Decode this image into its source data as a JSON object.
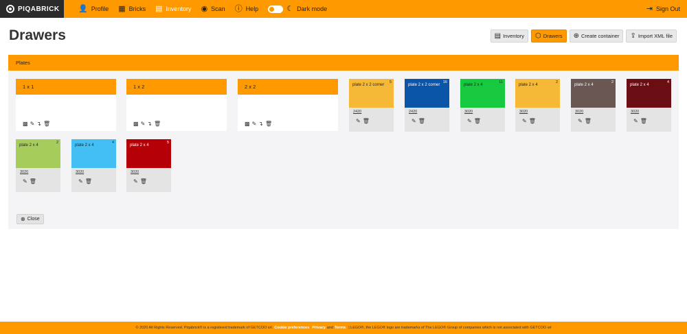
{
  "nav": {
    "brand": "PIQABRICK",
    "items": [
      {
        "label": "Profile",
        "icon": "user-icon",
        "glyph": "👤"
      },
      {
        "label": "Bricks",
        "icon": "grid-icon",
        "glyph": "▦"
      },
      {
        "label": "Inventory",
        "icon": "inventory-box-icon",
        "glyph": "▤"
      },
      {
        "label": "Scan",
        "icon": "eye-icon",
        "glyph": "◉"
      },
      {
        "label": "Help",
        "icon": "help-circle-icon",
        "glyph": "?"
      }
    ],
    "dark_mode_label": "Dark mode",
    "sign_out_label": "Sign Out"
  },
  "page": {
    "title": "Drawers",
    "actions": {
      "inventory": "Inventory",
      "drawers": "Drawers",
      "create": "Create container",
      "import": "Import XML file"
    }
  },
  "section": {
    "title": "Plates",
    "drawers": [
      {
        "label": "1 x 1"
      },
      {
        "label": "1 x 2"
      },
      {
        "label": "2 x 2"
      }
    ],
    "bricks": [
      {
        "name": "plate 2 x 2 corner",
        "count": "5",
        "part": "2420",
        "color": "#f6b937",
        "text": "#222"
      },
      {
        "name": "plate 2 x 2 corner",
        "count": "16",
        "part": "2420",
        "color": "#0b55a8",
        "text": "#fff"
      },
      {
        "name": "plate 2 x 4",
        "count": "11",
        "part": "3020",
        "color": "#16c93e",
        "text": "#222"
      },
      {
        "name": "plate 2 x 4",
        "count": "2",
        "part": "3020",
        "color": "#f6b937",
        "text": "#222"
      },
      {
        "name": "plate 2 x 4",
        "count": "2",
        "part": "3020",
        "color": "#6a5652",
        "text": "#fff"
      },
      {
        "name": "plate 2 x 4",
        "count": "4",
        "part": "3020",
        "color": "#6a0e14",
        "text": "#fff"
      },
      {
        "name": "plate 2 x 4",
        "count": "2",
        "part": "3020",
        "color": "#a6cd5c",
        "text": "#222"
      },
      {
        "name": "plate 2 x 4",
        "count": "4",
        "part": "3020",
        "color": "#43bff4",
        "text": "#222"
      },
      {
        "name": "plate 2 x 4",
        "count": "5",
        "part": "3020",
        "color": "#b40006",
        "text": "#fff"
      }
    ],
    "close_label": "Close"
  },
  "footer": {
    "pre": "© 2020 All Rights Reserved. Piqabrick® is a registered trademark of GETCOO srl.",
    "cookie": "Cookie preferences",
    "privacy": "Privacy",
    "and": "and",
    "terms": "Terms",
    "post": "| LEGO®, the LEGO® logo are trademarks of The LEGO® Group of companies which is not associated with GETCOO srl"
  }
}
